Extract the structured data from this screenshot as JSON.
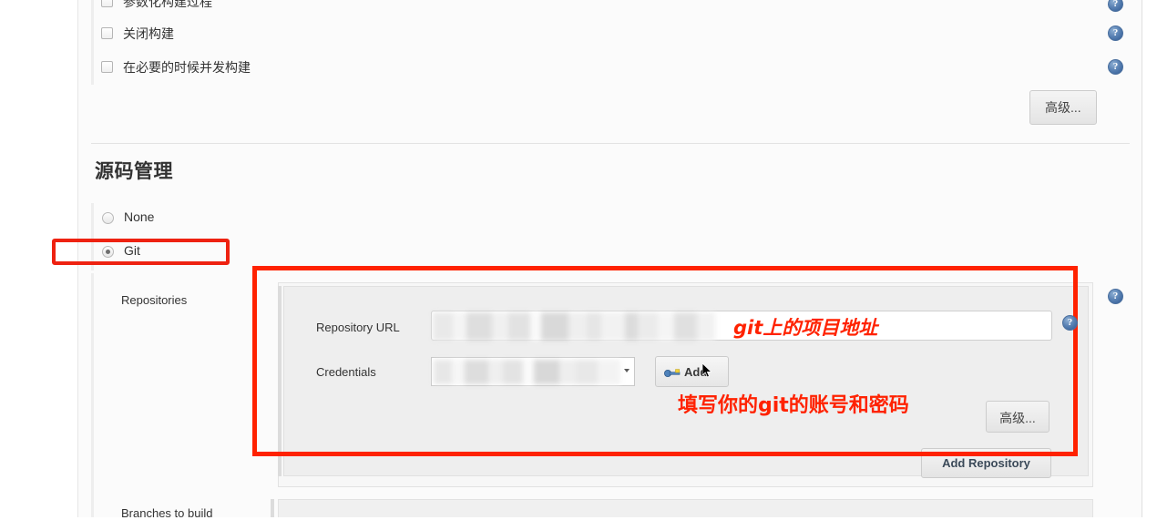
{
  "build_options": [
    {
      "label": "参数化构建过程",
      "checked": false
    },
    {
      "label": "关闭构建",
      "checked": false
    },
    {
      "label": "在必要的时候并发构建",
      "checked": false
    }
  ],
  "buttons": {
    "advanced_top": "高级...",
    "advanced_repo": "高级...",
    "add_repository": "Add Repository",
    "add_credentials": "Add"
  },
  "scm": {
    "heading": "源码管理",
    "options": [
      {
        "label": "None",
        "selected": false
      },
      {
        "label": "Git",
        "selected": true
      }
    ],
    "repositories_label": "Repositories",
    "branches_label": "Branches to build",
    "fields": {
      "repository_url_label": "Repository URL",
      "repository_url_value": "",
      "credentials_label": "Credentials",
      "credentials_value": ""
    }
  },
  "annotations": {
    "url_note": "git上的项目地址",
    "credentials_note": "填写你的git的账号和密码"
  },
  "icons": {
    "help": "?"
  },
  "colors": {
    "annotation_red": "#ff2200",
    "highlight_red": "#ee2211",
    "help_blue": "#2f5a94"
  }
}
